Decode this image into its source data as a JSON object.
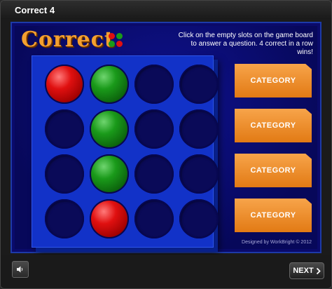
{
  "window": {
    "title": "Correct 4"
  },
  "logo": {
    "text": "Correct"
  },
  "instructions": "Click on the empty slots on the game board to answer a question.  4 correct in a row wins!",
  "board": {
    "rows": [
      [
        "red",
        "green",
        "empty",
        "empty"
      ],
      [
        "empty",
        "green",
        "empty",
        "empty"
      ],
      [
        "empty",
        "green",
        "empty",
        "empty"
      ],
      [
        "empty",
        "red",
        "empty",
        "empty"
      ]
    ]
  },
  "categories": [
    "CATEGORY",
    "CATEGORY",
    "CATEGORY",
    "CATEGORY"
  ],
  "credit": "Designed by WorkBright © 2012",
  "controls": {
    "next_label": "NEXT",
    "next_icon": "chevron-right-icon",
    "sound_icon": "speaker-icon"
  },
  "colors": {
    "accent": "#f29232",
    "stage": "#0a0a6a",
    "board": "#1232c8"
  }
}
